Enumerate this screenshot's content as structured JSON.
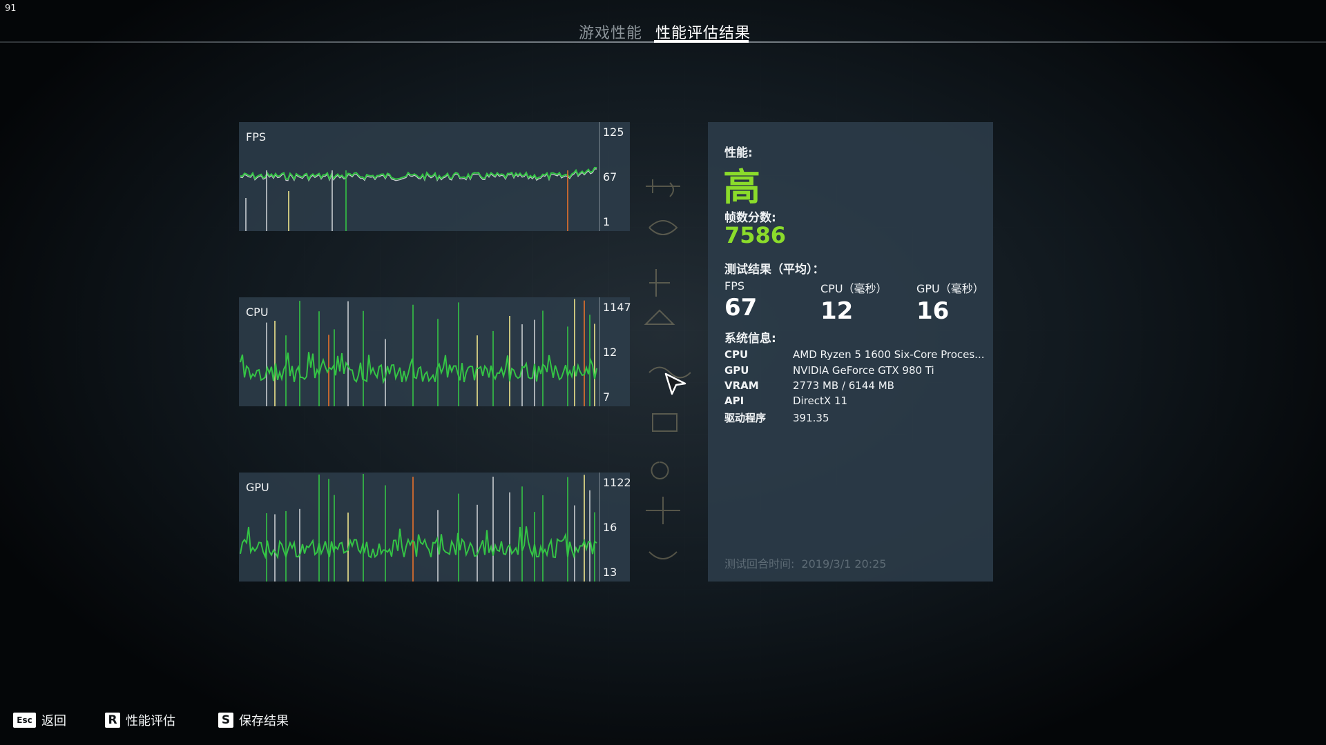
{
  "overlay": {
    "fps_counter": "91"
  },
  "header": {
    "tabs": [
      {
        "label": "游戏性能",
        "active": false
      },
      {
        "label": "性能评估结果",
        "active": true
      }
    ]
  },
  "charts": [
    {
      "title": "FPS",
      "ticks": {
        "top": "125",
        "mid": "67",
        "bottom": "1"
      }
    },
    {
      "title": "CPU",
      "ticks": {
        "top": "1147",
        "mid": "12",
        "bottom": "7"
      }
    },
    {
      "title": "GPU",
      "ticks": {
        "top": "1122",
        "mid": "16",
        "bottom": "13"
      }
    }
  ],
  "results": {
    "performance_label": "性能:",
    "performance_value": "高",
    "frame_score_label": "帧数分数:",
    "frame_score_value": "7586",
    "test_results_label": "测试结果（平均）：",
    "metrics": [
      {
        "name": "FPS",
        "value": "67"
      },
      {
        "name": "CPU（毫秒）",
        "value": "12"
      },
      {
        "name": "GPU（毫秒）",
        "value": "16"
      }
    ],
    "system_info_label": "系统信息:",
    "system_info": [
      {
        "key": "CPU",
        "value": "AMD Ryzen 5 1600 Six-Core Proces..."
      },
      {
        "key": "GPU",
        "value": "NVIDIA GeForce GTX 980 Ti"
      },
      {
        "key": "VRAM",
        "value": "2773 MB / 6144 MB"
      },
      {
        "key": "API",
        "value": "DirectX 11"
      },
      {
        "key": "驱动程序",
        "value": "391.35"
      }
    ],
    "test_time_label": "测试回合时间:",
    "test_time_value": "2019/3/1 20:25"
  },
  "footer": {
    "hints": [
      {
        "key": "Esc",
        "label": "返回"
      },
      {
        "key": "R",
        "label": "性能评估"
      },
      {
        "key": "S",
        "label": "保存结果"
      }
    ]
  },
  "colors": {
    "accent_green": "#8bdc2b",
    "line_green": "#34c445",
    "spike_orange": "#e8722a",
    "spike_yellow": "#f0e68c",
    "spike_gray": "#c9cdd0"
  },
  "icons": {
    "cursor": "mouse-pointer-icon"
  }
}
